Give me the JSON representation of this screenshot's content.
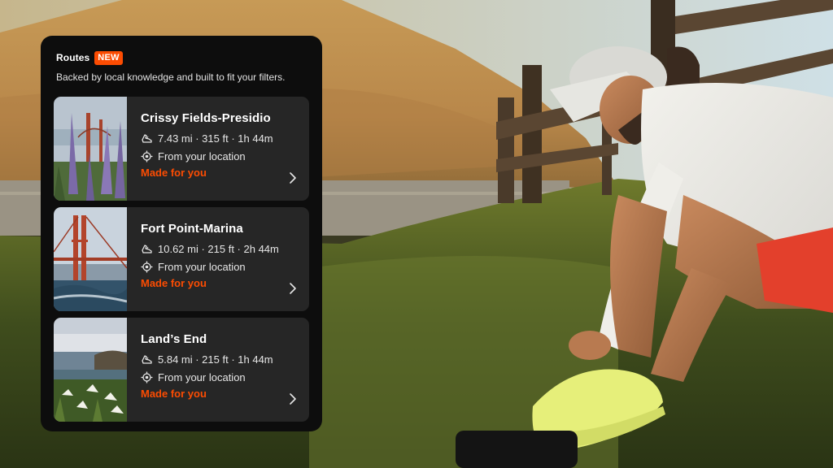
{
  "panel": {
    "title": "Routes",
    "badge": "NEW",
    "subtitle": "Backed by local knowledge and built to fit your filters."
  },
  "routes": [
    {
      "name": "Crissy Fields-Presidio",
      "stats": "7.43 mi · 315 ft · 1h 44m",
      "start": "From your location",
      "tag": "Made for you",
      "thumbnail": "golden-gate-flowers"
    },
    {
      "name": "Fort Point-Marina",
      "stats": "10.62 mi · 215 ft · 2h 44m",
      "start": "From your location",
      "tag": "Made for you",
      "thumbnail": "golden-gate-bridge-surf"
    },
    {
      "name": "Land’s End",
      "stats": "5.84 mi · 215 ft · 1h 44m",
      "start": "From your location",
      "tag": "Made for you",
      "thumbnail": "lands-end-lilies"
    }
  ],
  "icons": {
    "stats": "shoe-icon",
    "start": "location-target-icon",
    "open": "chevron-right-icon"
  },
  "colors": {
    "accent": "#fc4c02",
    "panel_bg": "#0d0d0d",
    "card_bg": "#262626"
  }
}
